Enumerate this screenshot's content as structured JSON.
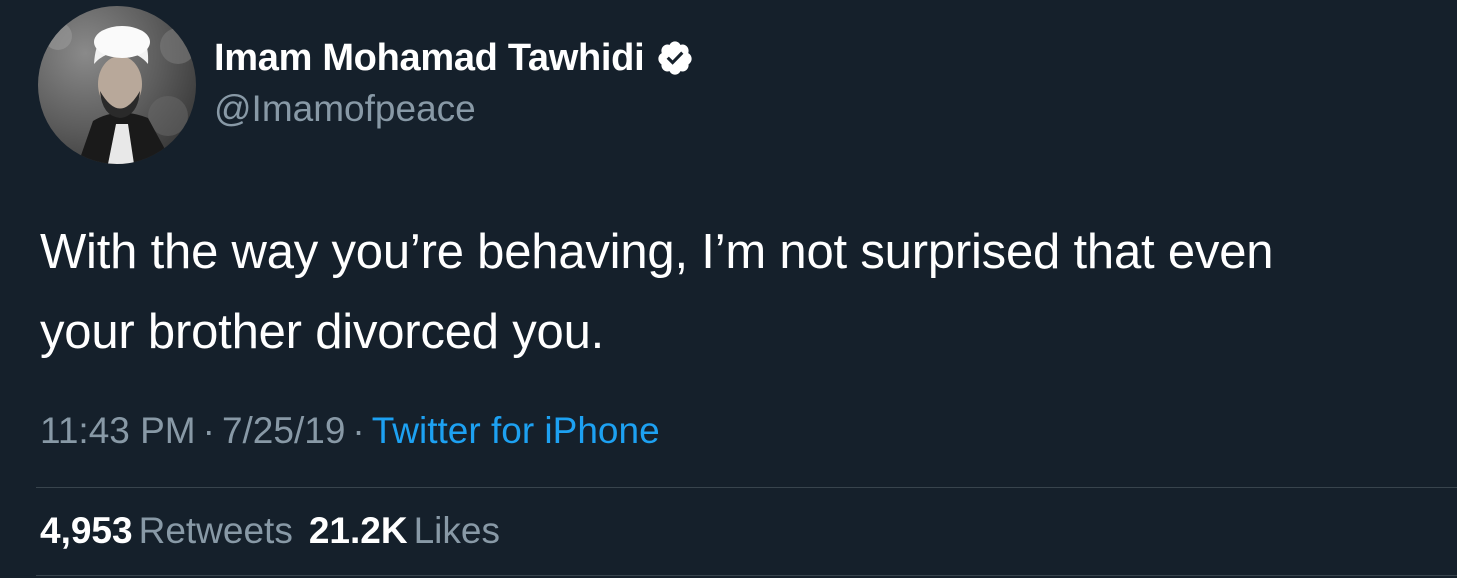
{
  "author": {
    "display_name": "Imam Mohamad Tawhidi",
    "handle": "@Imamofpeace",
    "verified": true,
    "avatar_icon": "avatar-photo"
  },
  "tweet": {
    "text_lines": [
      "With the way you’re behaving, I’m not surprised that even",
      "your brother divorced you."
    ],
    "time": "11:43 PM",
    "date": "7/25/19",
    "separator": "·",
    "source": "Twitter for iPhone"
  },
  "stats": {
    "retweets_count": "4,953",
    "retweets_label": "Retweets",
    "likes_count": "21.2K",
    "likes_label": "Likes"
  },
  "colors": {
    "background": "#15202b",
    "text_primary": "#ffffff",
    "text_secondary": "#8899a6",
    "accent": "#1da1f2",
    "divider": "#38444d"
  }
}
